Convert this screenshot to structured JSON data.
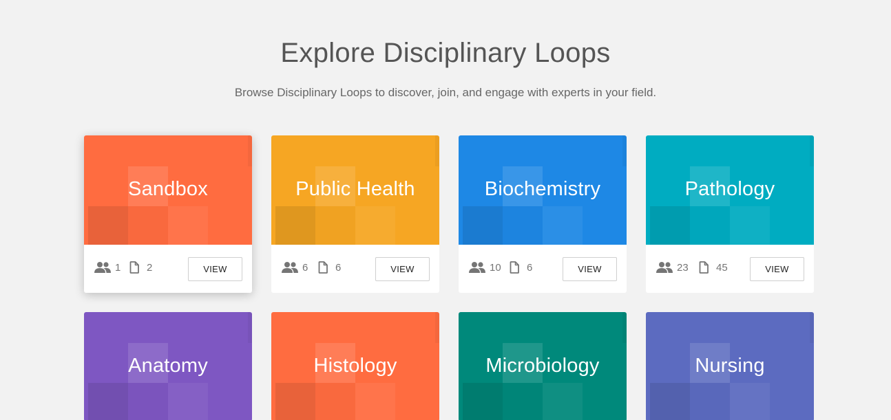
{
  "header": {
    "title": "Explore Disciplinary Loops",
    "subtitle": "Browse Disciplinary Loops to discover, join, and engage with experts in your field."
  },
  "icons": {
    "members": "people-icon",
    "documents": "document-icon"
  },
  "cards": [
    {
      "title": "Sandbox",
      "color": "#FF6C40",
      "members": "1",
      "documents": "2",
      "button_label": "VIEW"
    },
    {
      "title": "Public Health",
      "color": "#F6A623",
      "members": "6",
      "documents": "6",
      "button_label": "VIEW"
    },
    {
      "title": "Biochemistry",
      "color": "#1E88E5",
      "members": "10",
      "documents": "6",
      "button_label": "VIEW"
    },
    {
      "title": "Pathology",
      "color": "#00ACC1",
      "members": "23",
      "documents": "45",
      "button_label": "VIEW"
    },
    {
      "title": "Anatomy",
      "color": "#7E57C2"
    },
    {
      "title": "Histology",
      "color": "#FF6C40"
    },
    {
      "title": "Microbiology",
      "color": "#00897B"
    },
    {
      "title": "Nursing",
      "color": "#5C6BC0"
    }
  ]
}
